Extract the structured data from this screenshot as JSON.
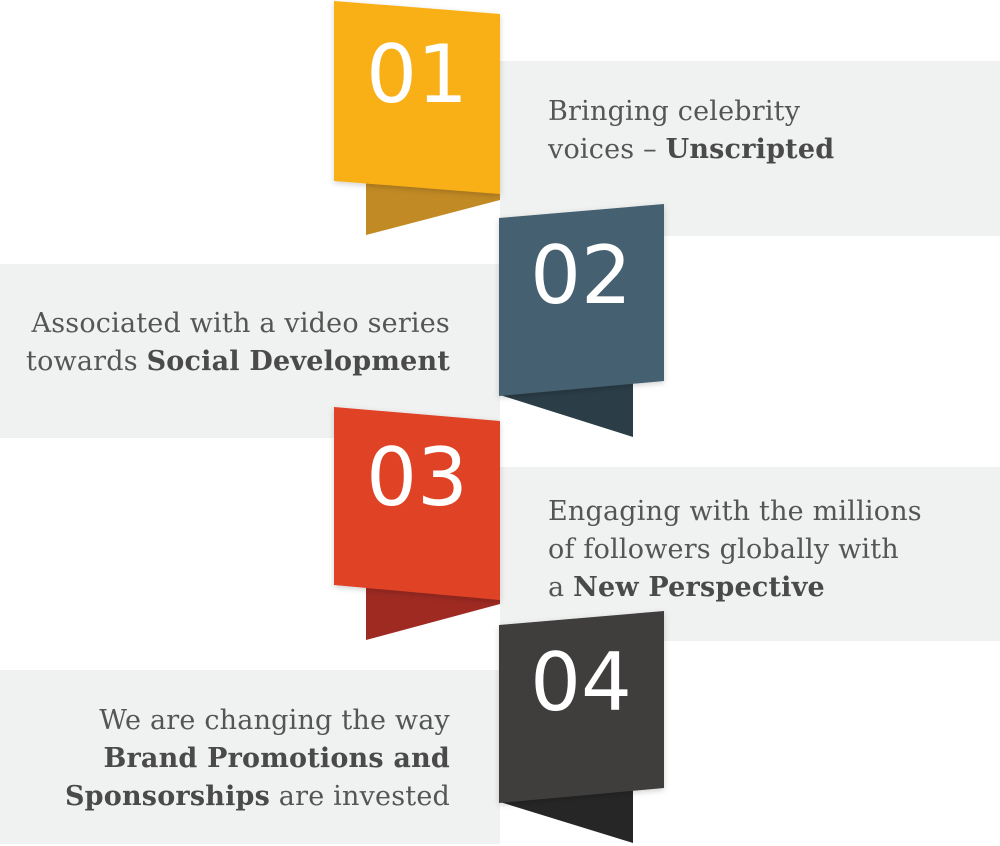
{
  "steps": [
    {
      "number": "01",
      "color": "#f9b019",
      "fold_color": "#c28a24",
      "lines": [
        {
          "pre": "Bringing celebrity",
          "bold": "",
          "post": ""
        },
        {
          "pre": "voices – ",
          "bold": "Unscripted",
          "post": ""
        }
      ]
    },
    {
      "number": "02",
      "color": "#44606f",
      "fold_color": "#2b3d47",
      "lines": [
        {
          "pre": "Associated with a video series",
          "bold": "",
          "post": ""
        },
        {
          "pre": "towards ",
          "bold": "Social Development",
          "post": ""
        }
      ]
    },
    {
      "number": "03",
      "color": "#e04327",
      "fold_color": "#9e2a22",
      "lines": [
        {
          "pre": "Engaging with the millions",
          "bold": "",
          "post": ""
        },
        {
          "pre": "of followers globally with",
          "bold": "",
          "post": ""
        },
        {
          "pre": "a ",
          "bold": "New Perspective",
          "post": ""
        }
      ]
    },
    {
      "number": "04",
      "color": "#3f3e3d",
      "fold_color": "#262626",
      "lines": [
        {
          "pre": "We are changing the way",
          "bold": "",
          "post": ""
        },
        {
          "pre": "",
          "bold": "Brand Promotions and",
          "post": ""
        },
        {
          "pre": "",
          "bold": "Sponsorships",
          "post": " are invested"
        }
      ]
    }
  ]
}
